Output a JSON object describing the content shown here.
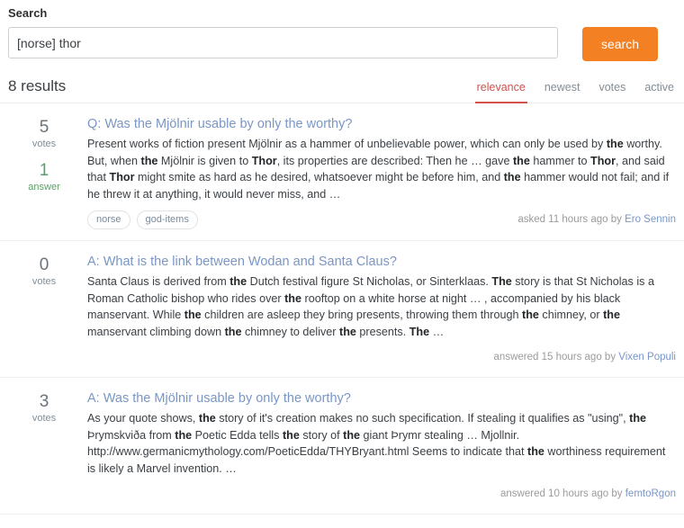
{
  "search": {
    "label": "Search",
    "query": "[norse] thor",
    "placeholder": "search",
    "button_label": "search"
  },
  "results_header": {
    "count_text": "8 results",
    "sort_tabs": [
      {
        "label": "relevance",
        "active": true
      },
      {
        "label": "newest",
        "active": false
      },
      {
        "label": "votes",
        "active": false
      },
      {
        "label": "active",
        "active": false
      }
    ]
  },
  "colors": {
    "accent_orange": "#f48024",
    "active_tab_red": "#d0524f",
    "link_blue": "#7996c7",
    "answered_green": "#5b9e6a",
    "muted_gray": "#848d95"
  },
  "results": [
    {
      "votes": "5",
      "votes_label": "votes",
      "answers": "1",
      "answers_label": "answer",
      "has_answers": true,
      "title": "Q: Was the Mjölnir usable by only the worthy?",
      "excerpt_parts": [
        {
          "t": "Present works of fiction present Mjölnir as a hammer of unbelievable power, which can only be used by ",
          "b": false
        },
        {
          "t": "the",
          "b": true
        },
        {
          "t": " worthy. But, when ",
          "b": false
        },
        {
          "t": "the",
          "b": true
        },
        {
          "t": " Mjölnir is given to ",
          "b": false
        },
        {
          "t": "Thor",
          "b": true
        },
        {
          "t": ", its properties are described: Then he … gave ",
          "b": false
        },
        {
          "t": "the",
          "b": true
        },
        {
          "t": " hammer to ",
          "b": false
        },
        {
          "t": "Thor",
          "b": true
        },
        {
          "t": ", and said that ",
          "b": false
        },
        {
          "t": "Thor",
          "b": true
        },
        {
          "t": " might smite as hard as he desired, whatsoever might be before him, and ",
          "b": false
        },
        {
          "t": "the",
          "b": true
        },
        {
          "t": " hammer would not fail; and if he threw it at anything, it would never miss, and …",
          "b": false
        }
      ],
      "tags": [
        "norse",
        "god-items"
      ],
      "meta_prefix": "asked 11 hours ago by ",
      "meta_user": "Ero Sennin"
    },
    {
      "votes": "0",
      "votes_label": "votes",
      "answers": null,
      "answers_label": null,
      "has_answers": false,
      "title": "A: What is the link between Wodan and Santa Claus?",
      "excerpt_parts": [
        {
          "t": "Santa Claus is derived from ",
          "b": false
        },
        {
          "t": "the",
          "b": true
        },
        {
          "t": " Dutch festival figure St Nicholas, or Sinterklaas. ",
          "b": false
        },
        {
          "t": "The",
          "b": true
        },
        {
          "t": " story is that St Nicholas is a Roman Catholic bishop who rides over ",
          "b": false
        },
        {
          "t": "the",
          "b": true
        },
        {
          "t": " rooftop on a white horse at night … , accompanied by his black manservant. While ",
          "b": false
        },
        {
          "t": "the",
          "b": true
        },
        {
          "t": " children are asleep they bring presents, throwing them through ",
          "b": false
        },
        {
          "t": "the",
          "b": true
        },
        {
          "t": " chimney, or ",
          "b": false
        },
        {
          "t": "the",
          "b": true
        },
        {
          "t": " manservant climbing down ",
          "b": false
        },
        {
          "t": "the",
          "b": true
        },
        {
          "t": " chimney to deliver ",
          "b": false
        },
        {
          "t": "the",
          "b": true
        },
        {
          "t": " presents. ",
          "b": false
        },
        {
          "t": "The",
          "b": true
        },
        {
          "t": " …",
          "b": false
        }
      ],
      "tags": [],
      "meta_prefix": "answered 15 hours ago by ",
      "meta_user": "Vixen Populi"
    },
    {
      "votes": "3",
      "votes_label": "votes",
      "answers": null,
      "answers_label": null,
      "has_answers": false,
      "title": "A: Was the Mjölnir usable by only the worthy?",
      "excerpt_parts": [
        {
          "t": "As your quote shows, ",
          "b": false
        },
        {
          "t": "the",
          "b": true
        },
        {
          "t": " story of it's creation makes no such specification. If stealing it qualifies as \"using\", ",
          "b": false
        },
        {
          "t": "the",
          "b": true
        },
        {
          "t": " Þrymskviða from ",
          "b": false
        },
        {
          "t": "the",
          "b": true
        },
        {
          "t": " Poetic Edda tells ",
          "b": false
        },
        {
          "t": "the",
          "b": true
        },
        {
          "t": " story of ",
          "b": false
        },
        {
          "t": "the",
          "b": true
        },
        {
          "t": " giant Þrymr stealing … Mjollnir. http://www.germanicmythology.com/PoeticEdda/THYBryant.html Seems to indicate that ",
          "b": false
        },
        {
          "t": "the",
          "b": true
        },
        {
          "t": " worthiness requirement is likely a Marvel invention. …",
          "b": false
        }
      ],
      "tags": [],
      "meta_prefix": "answered 10 hours ago by ",
      "meta_user": "femtoRgon"
    }
  ]
}
